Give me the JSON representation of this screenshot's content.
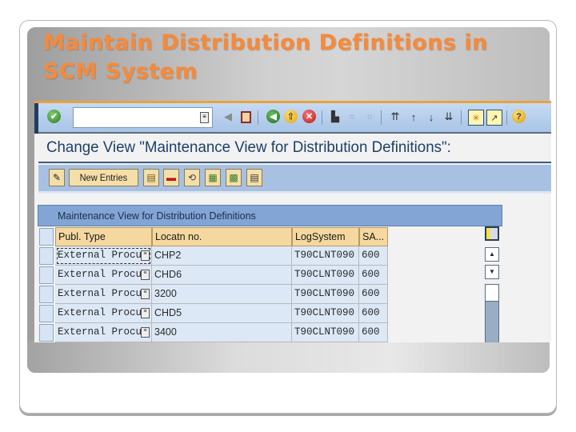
{
  "slide": {
    "title_line1": "Maintain Distribution Definitions in",
    "title_line2": "SCM System"
  },
  "colors": {
    "title_orange": "#f58a3c",
    "sap_toolbar_blue": "#a9c4e6",
    "header_cell": "#f5d8a0",
    "data_cell": "#dce8f6",
    "title_blue": "#1d3f6a"
  },
  "sap": {
    "command_field": {
      "value": "",
      "placeholder": ""
    },
    "system_toolbar_icons": [
      "enter-check-icon",
      "command-field-help-icon",
      "collapse-arrow-icon",
      "save-icon",
      "back-icon",
      "exit-icon",
      "cancel-icon",
      "print-icon",
      "find-icon",
      "find-next-icon",
      "first-page-icon",
      "previous-page-icon",
      "next-page-icon",
      "last-page-icon",
      "create-session-icon",
      "shortcut-icon",
      "help-icon"
    ],
    "view_title": "Change View \"Maintenance View for Distribution Definitions\": ",
    "app_toolbar": {
      "display_change_icon": "pencil-glasses-icon",
      "new_entries_label": "New Entries",
      "icons": [
        "copy-as-icon",
        "delete-icon",
        "undo-change-icon",
        "select-all-icon",
        "select-block-icon",
        "deselect-all-icon"
      ]
    },
    "table": {
      "title": "Maintenance View for Distribution Definitions",
      "columns": [
        "Publ. Type",
        "Locatn no.",
        "LogSystem",
        "SA..."
      ],
      "rows": [
        {
          "publ_type": "External Procu",
          "location": "CHP2",
          "log_system": "T90CLNT090",
          "sa": "600"
        },
        {
          "publ_type": "External Procu",
          "location": "CHD6",
          "log_system": "T90CLNT090",
          "sa": "600"
        },
        {
          "publ_type": "External Procu",
          "location": "3200",
          "log_system": "T90CLNT090",
          "sa": "600"
        },
        {
          "publ_type": "External Procu",
          "location": "CHD5",
          "log_system": "T90CLNT090",
          "sa": "600"
        },
        {
          "publ_type": "External Procu",
          "location": "3400",
          "log_system": "T90CLNT090",
          "sa": "600"
        }
      ]
    }
  }
}
